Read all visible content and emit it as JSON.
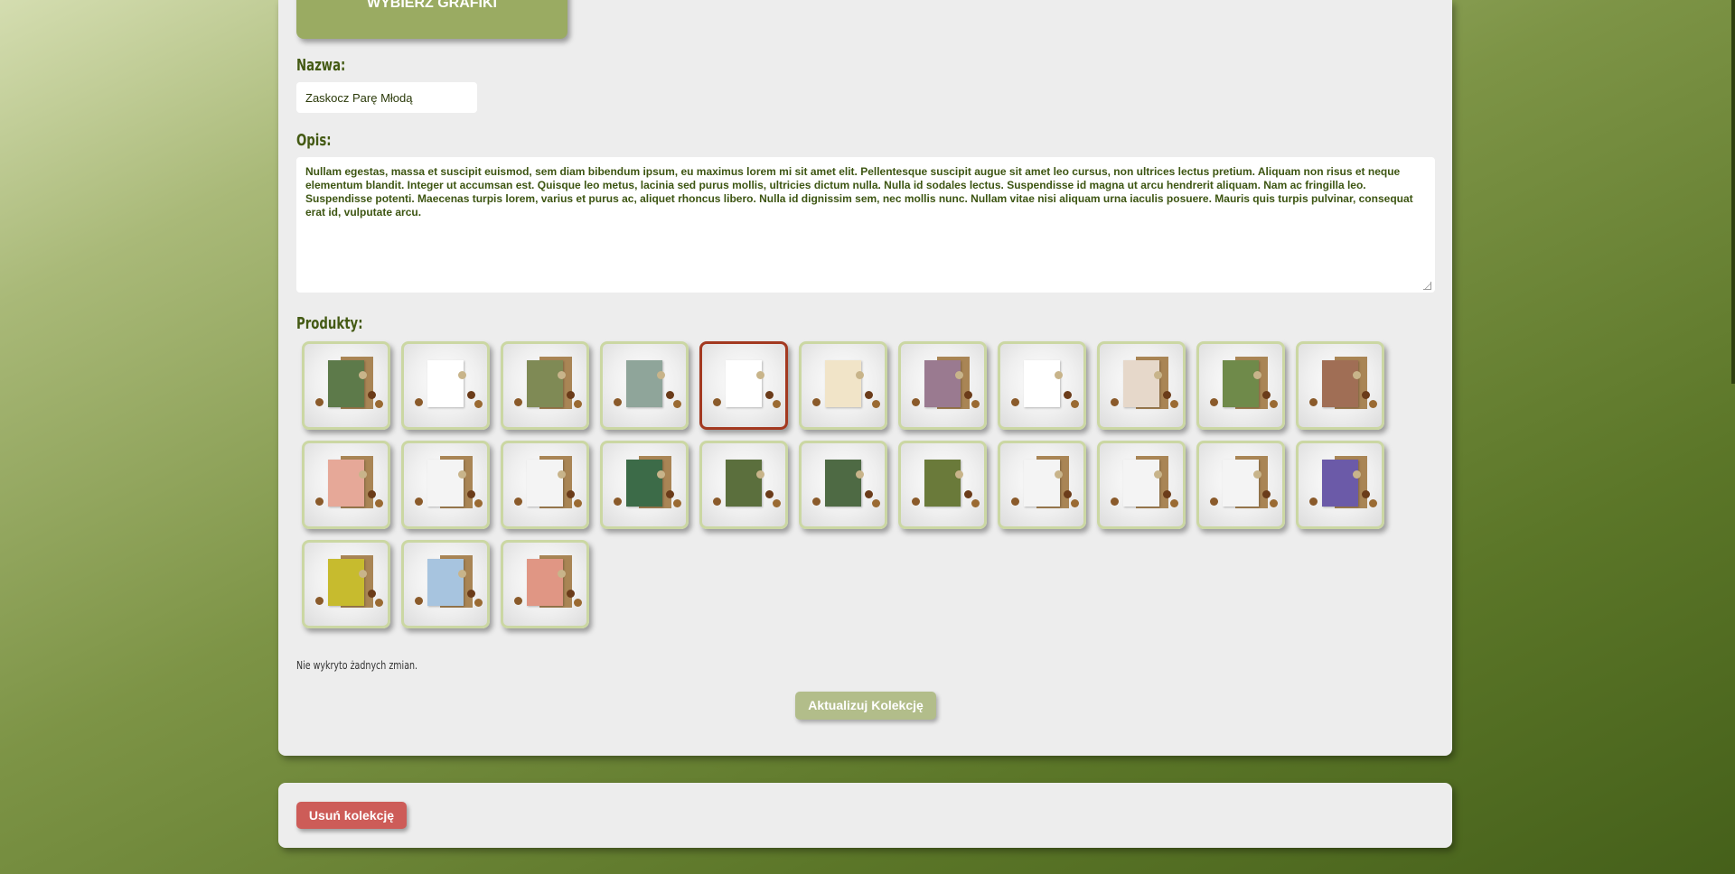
{
  "buttons": {
    "choose_graphic": "WYBIERZ GRAFIKI",
    "update_collection": "Aktualizuj Kolekcję",
    "delete_collection": "Usuń kolekcję"
  },
  "form": {
    "name_label": "Nazwa:",
    "name_value": "Zaskocz Parę Młodą",
    "description_label": "Opis:",
    "description_value": "Nullam egestas, massa et suscipit euismod, sem diam bibendum ipsum, eu maximus lorem mi sit amet elit. Pellentesque suscipit augue sit amet leo cursus, non ultrices lectus pretium. Aliquam non risus et neque elementum blandit. Integer ut accumsan est. Quisque leo metus, lacinia sed purus mollis, ultricies dictum nulla. Nulla id sodales lectus. Suspendisse id magna ut arcu hendrerit aliquam. Nam ac fringilla leo. Suspendisse potenti. Maecenas turpis lorem, varius et purus ac, aliquet rhoncus libero. Nulla id dignissim sem, nec mollis nunc. Nullam vitae nisi aliquam urna iaculis posuere. Mauris quis turpis pulvinar, consequat erat id, vulputate arcu.",
    "products_label": "Produkty:"
  },
  "status": "Nie wykryto żadnych zmian.",
  "colors": {
    "accent": "#9aab62",
    "selected_border": "#a33920",
    "tile_border": "#cbd7a3",
    "danger": "#cd5c58"
  },
  "products": [
    {
      "selected": false,
      "card": "#5d7a4a",
      "env": true
    },
    {
      "selected": false,
      "card": "#ffffff",
      "env": false
    },
    {
      "selected": false,
      "card": "#7f8a55",
      "env": true
    },
    {
      "selected": false,
      "card": "#8fa59a",
      "env": false
    },
    {
      "selected": true,
      "card": "#ffffff",
      "env": false
    },
    {
      "selected": false,
      "card": "#f1e4c8",
      "env": false
    },
    {
      "selected": false,
      "card": "#9a7a90",
      "env": true
    },
    {
      "selected": false,
      "card": "#ffffff",
      "env": false
    },
    {
      "selected": false,
      "card": "#e6d8ca",
      "env": true
    },
    {
      "selected": false,
      "card": "#6f8a4a",
      "env": true
    },
    {
      "selected": false,
      "card": "#a06e55",
      "env": true
    },
    {
      "selected": false,
      "card": "#e6a898",
      "env": true
    },
    {
      "selected": false,
      "card": "#f4f4f4",
      "env": true
    },
    {
      "selected": false,
      "card": "#f4f4f4",
      "env": true
    },
    {
      "selected": false,
      "card": "#3c6b48",
      "env": true
    },
    {
      "selected": false,
      "card": "#5b6f3d",
      "env": false
    },
    {
      "selected": false,
      "card": "#4e6a44",
      "env": false
    },
    {
      "selected": false,
      "card": "#6a7a3a",
      "env": false
    },
    {
      "selected": false,
      "card": "#f4f4f4",
      "env": true
    },
    {
      "selected": false,
      "card": "#f4f4f4",
      "env": true
    },
    {
      "selected": false,
      "card": "#f4f4f4",
      "env": true
    },
    {
      "selected": false,
      "card": "#6b5aa8",
      "env": true
    },
    {
      "selected": false,
      "card": "#c7bb2e",
      "env": true
    },
    {
      "selected": false,
      "card": "#a7c4df",
      "env": true
    },
    {
      "selected": false,
      "card": "#e09684",
      "env": true
    }
  ]
}
